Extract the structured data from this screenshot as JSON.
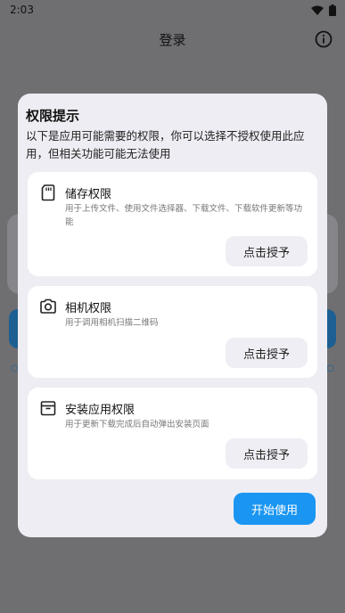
{
  "status": {
    "time": "2:03"
  },
  "app_bar": {
    "title": "登录"
  },
  "dialog": {
    "title": "权限提示",
    "description": "以下是应用可能需要的权限，你可以选择不授权使用此应用，但相关功能可能无法使用",
    "permissions": [
      {
        "title": "储存权限",
        "description": "用于上传文件、使用文件选择器、下载文件、下载软件更新等功能",
        "button": "点击授予",
        "icon": "sd-card-icon"
      },
      {
        "title": "相机权限",
        "description": "用于调用相机扫描二维码",
        "button": "点击授予",
        "icon": "camera-icon"
      },
      {
        "title": "安装应用权限",
        "description": "用于更新下载完成后自动弹出安装页面",
        "button": "点击授予",
        "icon": "archive-box-icon"
      }
    ],
    "start_button": "开始使用"
  },
  "colors": {
    "accent": "#1a96f2",
    "dialog_bg": "#eeedf3",
    "scrim": "#6f6f72"
  }
}
